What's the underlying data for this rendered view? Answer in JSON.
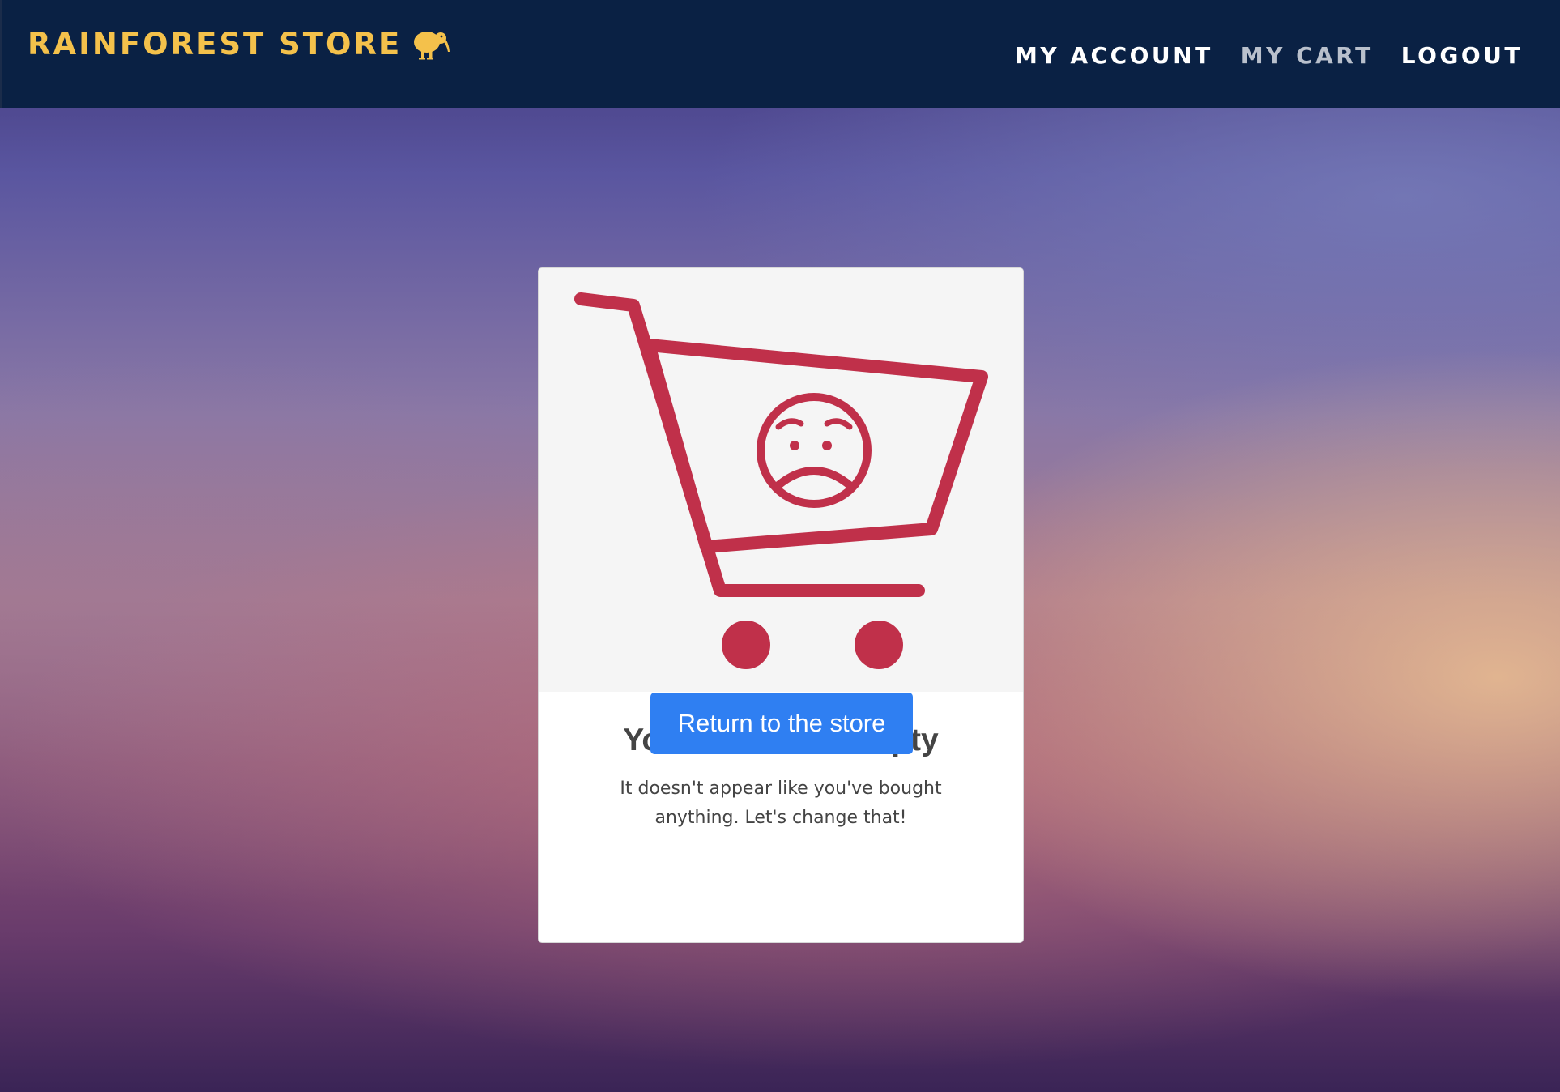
{
  "navbar": {
    "brand_label": "RAINFOREST STORE",
    "brand_icon": "kiwi-bird-icon",
    "links": [
      {
        "label": "MY ACCOUNT",
        "active": false
      },
      {
        "label": "MY CART",
        "active": true
      },
      {
        "label": "LOGOUT",
        "active": false
      }
    ]
  },
  "empty_cart": {
    "illustration_icon": "sad-shopping-cart-icon",
    "title": "Your basket is empty",
    "message_line1": "It doesn't appear like you've bought",
    "message_line2": "anything. Let's change that!",
    "button_label": "Return to the store"
  },
  "colors": {
    "navbar_bg": "#0a2144",
    "brand": "#f4c14b",
    "nav_active": "#b9c0cc",
    "cart_red": "#c0304a",
    "button_bg": "#2f7ff2"
  }
}
